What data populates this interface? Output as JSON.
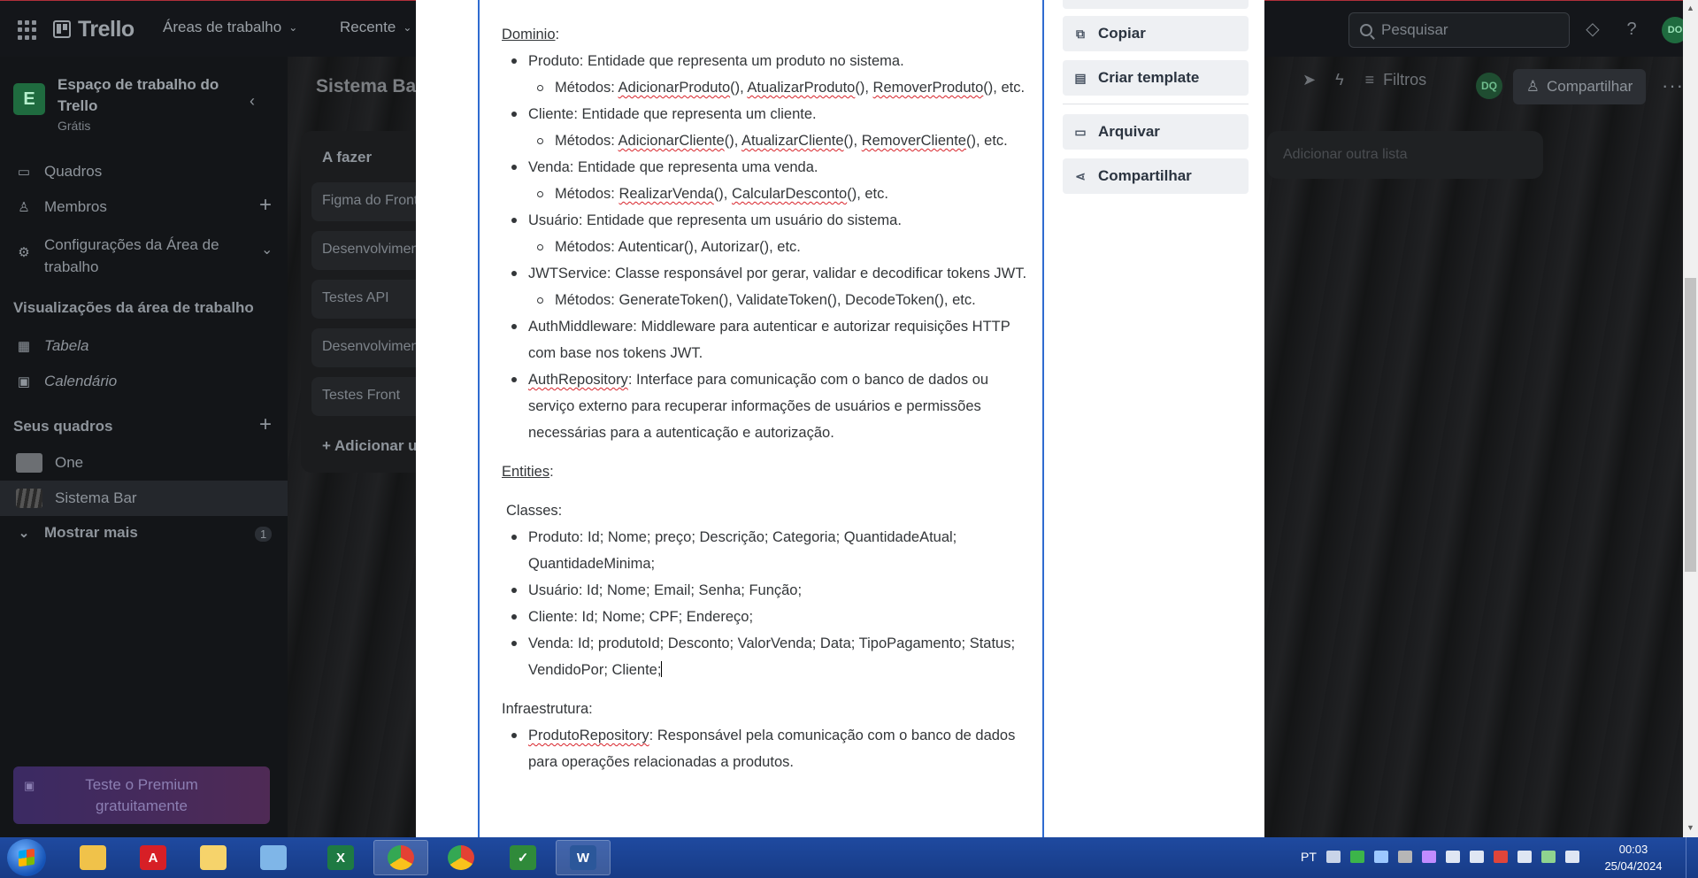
{
  "header": {
    "app_name": "Trello",
    "nav": [
      "Áreas de trabalho",
      "Recente"
    ],
    "search_placeholder": "Pesquisar",
    "user_initials": "DO"
  },
  "sidebar": {
    "workspace_name": "Espaço de trabalho do Trello",
    "workspace_letter": "E",
    "workspace_plan": "Grátis",
    "items": {
      "boards": "Quadros",
      "members": "Membros",
      "settings": "Configurações da Área de trabalho"
    },
    "views_title": "Visualizações da área de trabalho",
    "views": {
      "table": "Tabela",
      "calendar": "Calendário"
    },
    "your_boards_title": "Seus quadros",
    "boards": [
      {
        "name": "One",
        "color": "#6c6f73"
      },
      {
        "name": "Sistema Bar",
        "color": "#3a3c3f"
      }
    ],
    "show_more": "Mostrar mais",
    "show_more_count": "1",
    "premium": "Teste o Premium gratuitamente"
  },
  "board": {
    "title": "Sistema Bar",
    "list_title": "A fazer",
    "cards": [
      "Figma do Front",
      "Desenvolvimento",
      "Testes API",
      "Desenvolvimento",
      "Testes Front"
    ],
    "add_card": "Adicionar um cartão",
    "add_list": "Adicionar outra lista",
    "filters": "Filtros",
    "share": "Compartilhar",
    "member_initials": "DQ"
  },
  "modal": {
    "actions": {
      "copy": "Copiar",
      "template": "Criar template",
      "archive": "Arquivar",
      "share": "Compartilhar"
    },
    "doc": {
      "dominio_title": "Dominio",
      "produto": "Produto: Entidade que representa um produto no sistema.",
      "produto_metodos_label": "Métodos: ",
      "produto_m1": "AdicionarProduto",
      "produto_m2": "AtualizarProduto",
      "produto_m3": "RemoverProduto",
      "etc": "etc.",
      "cliente": "Cliente: Entidade que representa um cliente.",
      "cliente_m1": "AdicionarCliente",
      "cliente_m2": "AtualizarCliente",
      "cliente_m3": "RemoverCliente",
      "venda": "Venda: Entidade que representa uma venda.",
      "venda_m1": "RealizarVenda",
      "venda_m2": "CalcularDesconto",
      "usuario": "Usuário: Entidade que representa um usuário do sistema.",
      "usuario_metodos": "Métodos: Autenticar(), Autorizar(), etc.",
      "jwt": "JWTService: Classe responsável por gerar, validar e decodificar tokens JWT.",
      "jwt_metodos": "Métodos: GenerateToken(), ValidateToken(), DecodeToken(), etc.",
      "authmw": "AuthMiddleware: Middleware para autenticar e autorizar requisições HTTP com base nos tokens JWT.",
      "authrepo_name": "AuthRepository",
      "authrepo_text": ": Interface para comunicação com o banco de dados ou serviço externo para recuperar informações de usuários e permissões necessárias para a autenticação e autorização.",
      "entities_title": "Entities",
      "classes_label": "Classes:",
      "cls_produto": "Produto: Id; Nome; preço; Descrição; Categoria; QuantidadeAtual; QuantidadeMinima;",
      "cls_usuario": "Usuário: Id; Nome; Email; Senha; Função;",
      "cls_cliente": "Cliente: Id; Nome; CPF; Endereço;",
      "cls_venda": "Venda: Id; produtoId; Desconto; ValorVenda; Data; TipoPagamento; Status; VendidoPor; Cliente;",
      "infra_title": "Infraestrutura:",
      "prodrepo_name": "ProdutoRepository",
      "prodrepo_text": ": Responsável pela comunicação com o banco de dados para operações relacionadas a produtos."
    }
  },
  "taskbar": {
    "lang": "PT",
    "time": "00:03",
    "date": "25/04/2024",
    "apps": [
      {
        "name": "explorer",
        "color": "#f0c24a"
      },
      {
        "name": "acrobat",
        "color": "#d71f26"
      },
      {
        "name": "files",
        "color": "#f6d36b"
      },
      {
        "name": "notes",
        "color": "#7fb6e8"
      },
      {
        "name": "excel",
        "color": "#1e7a43"
      },
      {
        "name": "chrome-profile",
        "color": "#e44134"
      },
      {
        "name": "chrome",
        "color": "#e44134"
      },
      {
        "name": "sheets",
        "color": "#2f8a3a"
      },
      {
        "name": "word",
        "color": "#2b579a"
      }
    ]
  }
}
